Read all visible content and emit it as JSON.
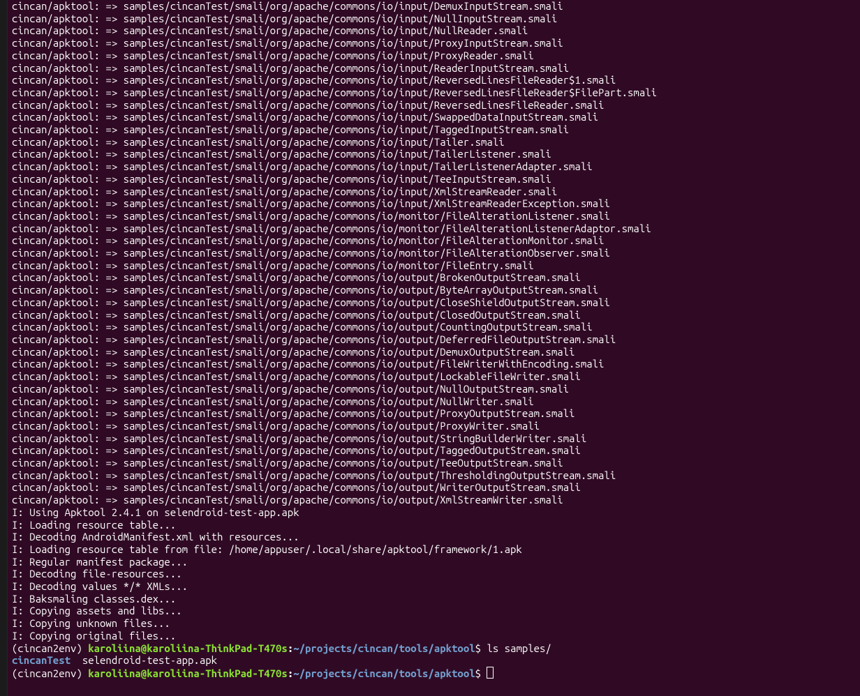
{
  "cincan_prefix": "cincan/apktool:",
  "arrow": " => ",
  "smali_path_prefix": "samples/cincanTest/smali/org/apache/commons/io/",
  "smali_lines": [
    "input/DemuxInputStream.smali",
    "input/NullInputStream.smali",
    "input/NullReader.smali",
    "input/ProxyInputStream.smali",
    "input/ProxyReader.smali",
    "input/ReaderInputStream.smali",
    "input/ReversedLinesFileReader$1.smali",
    "input/ReversedLinesFileReader$FilePart.smali",
    "input/ReversedLinesFileReader.smali",
    "input/SwappedDataInputStream.smali",
    "input/TaggedInputStream.smali",
    "input/Tailer.smali",
    "input/TailerListener.smali",
    "input/TailerListenerAdapter.smali",
    "input/TeeInputStream.smali",
    "input/XmlStreamReader.smali",
    "input/XmlStreamReaderException.smali",
    "monitor/FileAlterationListener.smali",
    "monitor/FileAlterationListenerAdaptor.smali",
    "monitor/FileAlterationMonitor.smali",
    "monitor/FileAlterationObserver.smali",
    "monitor/FileEntry.smali",
    "output/BrokenOutputStream.smali",
    "output/ByteArrayOutputStream.smali",
    "output/CloseShieldOutputStream.smali",
    "output/ClosedOutputStream.smali",
    "output/CountingOutputStream.smali",
    "output/DeferredFileOutputStream.smali",
    "output/DemuxOutputStream.smali",
    "output/FileWriterWithEncoding.smali",
    "output/LockableFileWriter.smali",
    "output/NullOutputStream.smali",
    "output/NullWriter.smali",
    "output/ProxyOutputStream.smali",
    "output/ProxyWriter.smali",
    "output/StringBuilderWriter.smali",
    "output/TaggedOutputStream.smali",
    "output/TeeOutputStream.smali",
    "output/ThresholdingOutputStream.smali",
    "output/WriterOutputStream.smali",
    "output/XmlStreamWriter.smali"
  ],
  "info_prefix": "I: ",
  "info_lines": [
    "Using Apktool 2.4.1 on selendroid-test-app.apk",
    "Loading resource table...",
    "Decoding AndroidManifest.xml with resources...",
    "Loading resource table from file: /home/appuser/.local/share/apktool/framework/1.apk",
    "Regular manifest package...",
    "Decoding file-resources...",
    "Decoding values */* XMLs...",
    "Baksmaling classes.dex...",
    "Copying assets and libs...",
    "Copying unknown files...",
    "Copying original files..."
  ],
  "prompt": {
    "env": "(cincan2env) ",
    "userhost": "karoliina@karoliina-ThinkPad-T470s",
    "colon": ":",
    "path": "~/projects/cincan/tools/apktool",
    "dollar": "$ "
  },
  "command1": "ls samples/",
  "ls_result": {
    "dir": "cincanTest",
    "spacer": "  ",
    "file": "selendroid-test-app.apk"
  },
  "command2": ""
}
